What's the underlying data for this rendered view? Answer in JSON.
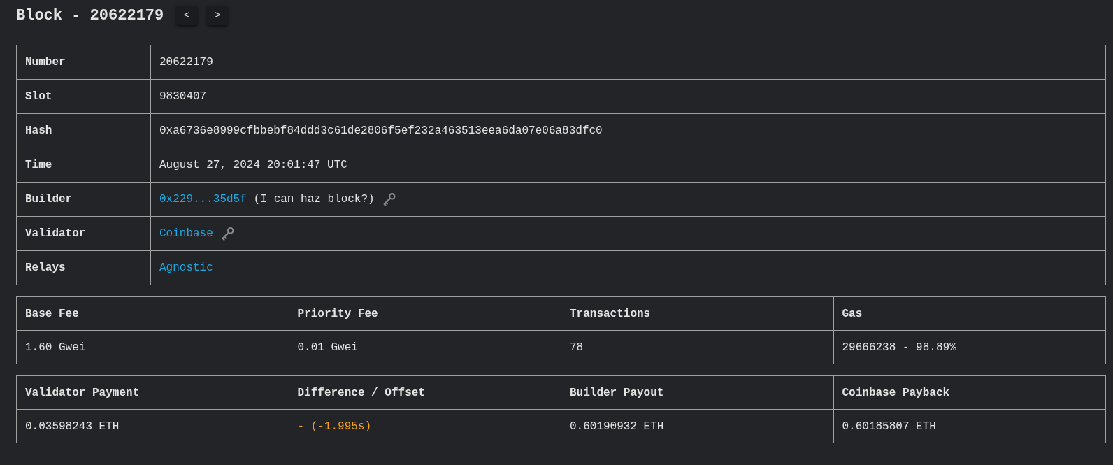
{
  "title": "Block - 20622179",
  "nav_buttons": [
    {
      "label": "<"
    },
    {
      "label": ">"
    }
  ],
  "details": [
    {
      "label": "Number",
      "parts": [
        {
          "kind": "text",
          "text": "20622179"
        }
      ],
      "key_icon": false
    },
    {
      "label": "Slot",
      "parts": [
        {
          "kind": "text",
          "text": "9830407"
        }
      ],
      "key_icon": false
    },
    {
      "label": "Hash",
      "parts": [
        {
          "kind": "text",
          "text": "0xa6736e8999cfbbebf84ddd3c61de2806f5ef232a463513eea6da07e06a83dfc0"
        }
      ],
      "key_icon": false
    },
    {
      "label": "Time",
      "parts": [
        {
          "kind": "text",
          "text": "August 27, 2024 20:01:47 UTC"
        }
      ],
      "key_icon": false
    },
    {
      "label": "Builder",
      "parts": [
        {
          "kind": "link",
          "text": "0x229...35d5f"
        },
        {
          "kind": "text",
          "text": "(I can haz block?)"
        }
      ],
      "key_icon": true
    },
    {
      "label": "Validator",
      "parts": [
        {
          "kind": "link",
          "text": "Coinbase"
        }
      ],
      "key_icon": true
    },
    {
      "label": "Relays",
      "parts": [
        {
          "kind": "link",
          "text": "Agnostic"
        }
      ],
      "key_icon": false
    }
  ],
  "stat_tables": [
    {
      "columns": [
        {
          "header": "Base Fee",
          "value": "1.60 Gwei",
          "color": "#e4e4e4"
        },
        {
          "header": "Priority Fee",
          "value": "0.01 Gwei",
          "color": "#e4e4e4"
        },
        {
          "header": "Transactions",
          "value": "78",
          "color": "#e4e4e4"
        },
        {
          "header": "Gas",
          "value": "29666238 - 98.89%",
          "color": "#e4e4e4"
        }
      ]
    },
    {
      "columns": [
        {
          "header": "Validator Payment",
          "value": "0.03598243 ETH",
          "color": "#e4e4e4"
        },
        {
          "header": "Difference / Offset",
          "value": "- (-1.995s)",
          "color": "#f0a020"
        },
        {
          "header": "Builder Payout",
          "value": "0.60190932 ETH",
          "color": "#e4e4e4"
        },
        {
          "header": "Coinbase Payback",
          "value": "0.60185807 ETH",
          "color": "#e4e4e4"
        }
      ]
    }
  ]
}
